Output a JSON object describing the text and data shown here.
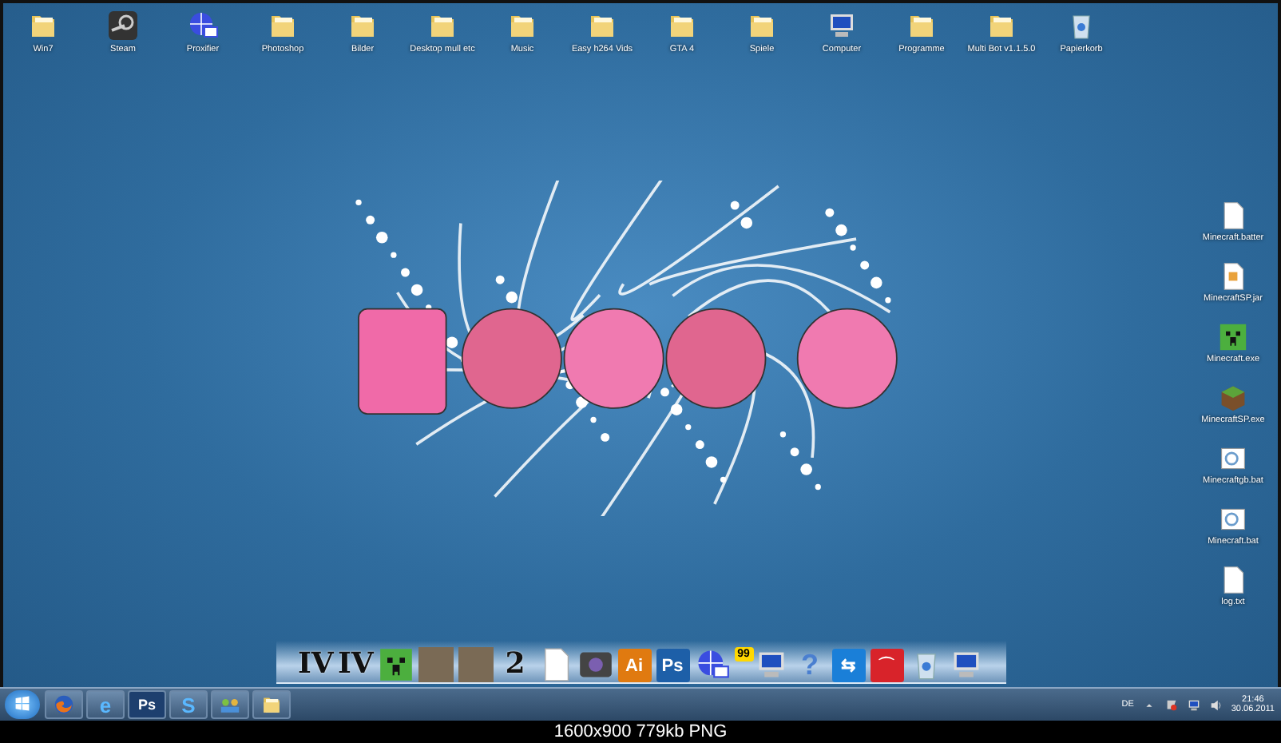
{
  "desktop_icons_top": [
    {
      "label": "Win7",
      "kind": "folder"
    },
    {
      "label": "Steam",
      "kind": "app"
    },
    {
      "label": "Proxifier",
      "kind": "globe"
    },
    {
      "label": "Photoshop",
      "kind": "folder"
    },
    {
      "label": "Bilder",
      "kind": "folder"
    },
    {
      "label": "Desktop mull etc",
      "kind": "folder"
    },
    {
      "label": "Music",
      "kind": "folder"
    },
    {
      "label": "Easy h264 Vids",
      "kind": "folder"
    },
    {
      "label": "GTA 4",
      "kind": "folder"
    },
    {
      "label": "Spiele",
      "kind": "folder"
    },
    {
      "label": "Computer",
      "kind": "computer"
    },
    {
      "label": "Programme",
      "kind": "folder"
    },
    {
      "label": "Multi Bot v1.1.5.0",
      "kind": "folder"
    },
    {
      "label": "Papierkorb",
      "kind": "trash"
    }
  ],
  "desktop_icons_right": [
    {
      "label": "Minecraft.batter",
      "kind": "file"
    },
    {
      "label": "MinecraftSP.jar",
      "kind": "jar"
    },
    {
      "label": "Minecraft.exe",
      "kind": "creeper"
    },
    {
      "label": "MinecraftSP.exe",
      "kind": "block"
    },
    {
      "label": "Minecraftgb.bat",
      "kind": "bat"
    },
    {
      "label": "Minecraft.bat",
      "kind": "bat"
    },
    {
      "label": "log.txt",
      "kind": "file"
    }
  ],
  "dock": [
    {
      "kind": "text",
      "text": "IV"
    },
    {
      "kind": "text",
      "text": "IV"
    },
    {
      "kind": "creeper"
    },
    {
      "kind": "photo"
    },
    {
      "kind": "photo"
    },
    {
      "kind": "text",
      "text": "2"
    },
    {
      "kind": "file"
    },
    {
      "kind": "camera"
    },
    {
      "kind": "tile",
      "text": "Ai",
      "color": "#e07a10"
    },
    {
      "kind": "tile",
      "text": "Ps",
      "color": "#1d5fa8"
    },
    {
      "kind": "globe"
    },
    {
      "kind": "monitor",
      "text": "99"
    },
    {
      "kind": "help",
      "text": "?"
    },
    {
      "kind": "tile",
      "text": "⇆",
      "color": "#1a7fd8"
    },
    {
      "kind": "tile",
      "text": "⌒",
      "color": "#d8232a"
    },
    {
      "kind": "trash"
    },
    {
      "kind": "computer"
    }
  ],
  "taskbar": {
    "pinned": [
      {
        "kind": "firefox"
      },
      {
        "kind": "ie",
        "text": "e"
      },
      {
        "kind": "tile",
        "text": "Ps"
      },
      {
        "kind": "skype",
        "text": "S"
      },
      {
        "kind": "network"
      },
      {
        "kind": "folder"
      }
    ],
    "language": "DE",
    "time": "21:46",
    "date": "30.06.2011"
  },
  "caption": "1600x900 779kb PNG"
}
